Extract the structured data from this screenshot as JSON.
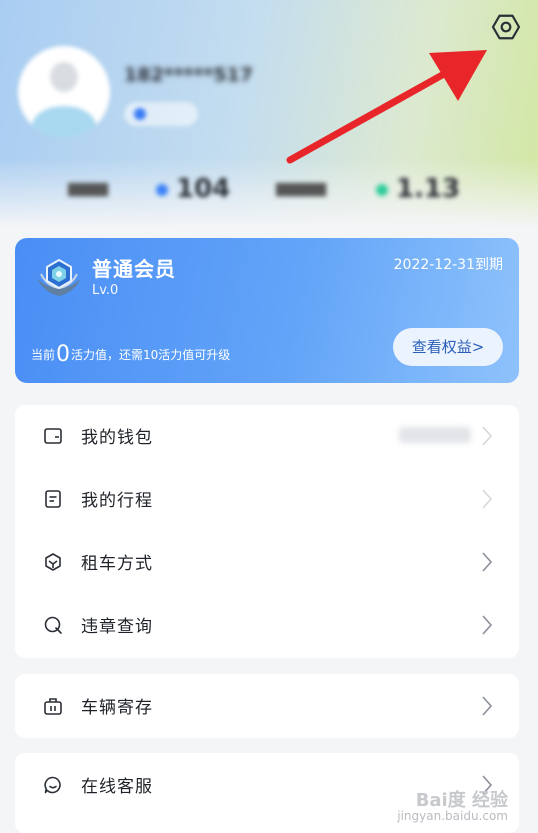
{
  "profile": {
    "username": "182*****517",
    "stats": [
      {
        "value": "104",
        "color": "#3b82f6"
      },
      {
        "value": "1.13",
        "color": "#2ecc9a"
      }
    ]
  },
  "icons": {
    "settings": "hexagon-settings-icon",
    "annotation": "red-arrow-pointer"
  },
  "membership": {
    "title": "普通会员",
    "level": "Lv.0",
    "expire": "2022-12-31到期",
    "progress_prefix": "当前",
    "progress_value": "0",
    "progress_suffix": "活力值，还需10活力值可升级",
    "button": "查看权益>"
  },
  "menu_group_1": [
    {
      "label": "我的钱包",
      "icon": "wallet-icon"
    },
    {
      "label": "我的行程",
      "icon": "trip-icon"
    },
    {
      "label": "租车方式",
      "icon": "rental-mode-icon"
    },
    {
      "label": "违章查询",
      "icon": "violation-search-icon"
    }
  ],
  "menu_group_2": [
    {
      "label": "车辆寄存",
      "icon": "vehicle-storage-icon"
    }
  ],
  "menu_group_3": [
    {
      "label": "在线客服",
      "icon": "customer-service-icon"
    }
  ],
  "watermark": {
    "brand": "Bai度 经验",
    "url": "jingyan.baidu.com"
  },
  "colors": {
    "accent": "#4a8ef5",
    "annotation_arrow": "#e8262a"
  }
}
